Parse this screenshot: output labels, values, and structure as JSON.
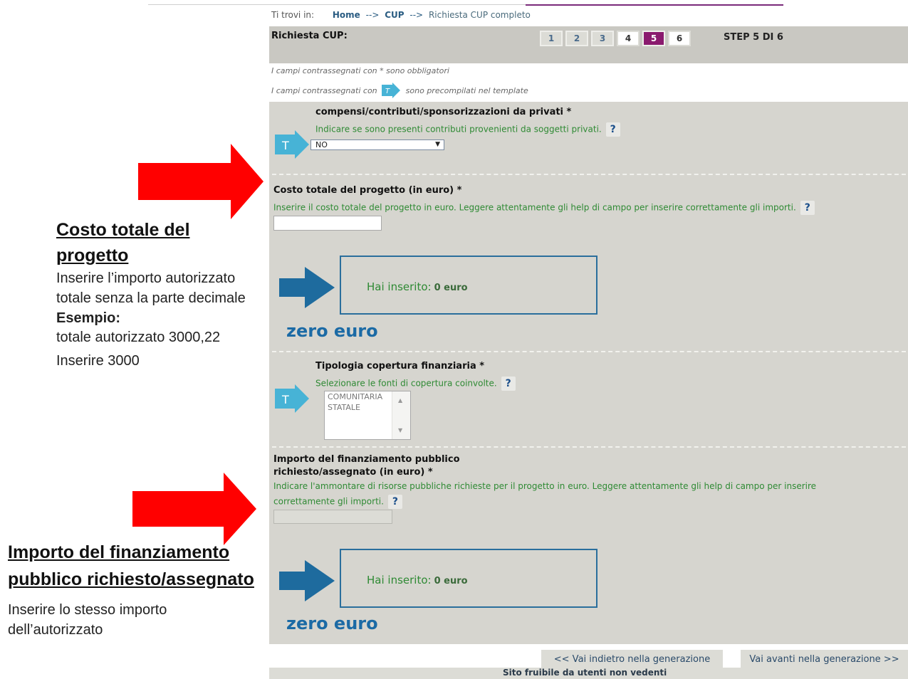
{
  "breadcrumb": {
    "label": "Ti trovi in:",
    "home": "Home",
    "sep1": "-->",
    "cup": "CUP",
    "sep2": "-->",
    "current": "Richiesta CUP completo"
  },
  "stepbar": {
    "title": "Richiesta CUP:",
    "steps": [
      "1",
      "2",
      "3",
      "4",
      "5",
      "6"
    ],
    "active_step": 5,
    "counter": "STEP 5 DI 6"
  },
  "notes": {
    "required": "I campi contrassegnati con * sono obbligatori",
    "prefilled_before": "I campi contrassegnati con",
    "prefilled_after": "sono precompilati nel template"
  },
  "fields": {
    "compensi": {
      "label": "compensi/contributi/sponsorizzazioni da privati *",
      "help": "Indicare se sono presenti contributi provenienti da soggetti privati.",
      "value": "NO"
    },
    "costo": {
      "label": "Costo totale del progetto (in euro) *",
      "help": "Inserire il costo totale del progetto in euro. Leggere attentamente gli help di campo per inserire correttamente gli importi.",
      "value": "",
      "result_label": "Hai inserito:",
      "result_value": "0 euro",
      "zero_text": "zero euro"
    },
    "tipologia": {
      "label": "Tipologia copertura finanziaria *",
      "help": "Selezionare le fonti di copertura coinvolte.",
      "options": [
        "COMUNITARIA",
        "STATALE"
      ]
    },
    "importo": {
      "label_line1": "Importo del finanziamento pubblico",
      "label_line2": "richiesto/assegnato (in euro) *",
      "help_line1": "Indicare l'ammontare di risorse pubbliche richieste per il progetto in euro. Leggere attentamente gli help di campo per inserire",
      "help_line2": "correttamente gli importi.",
      "result_label": "Hai inserito:",
      "result_value": "0 euro",
      "zero_text": "zero euro"
    }
  },
  "help_icon": "?",
  "badge_letter": "T",
  "navigation": {
    "back": "<< Vai indietro nella generazione",
    "forward": "Vai avanti nella generazione >>",
    "accessibility": "Sito fruibile da utenti non vedenti"
  },
  "annotations": {
    "costo": {
      "title_line1": "Costo totale del",
      "title_line2": "progetto",
      "line1": "Inserire l’importo autorizzato",
      "line2": "totale senza la parte decimale",
      "example_label": "Esempio:",
      "example_line": "totale autorizzato 3000,22",
      "insert_line": "Inserire 3000"
    },
    "importo": {
      "title_line1": "Importo del finanziamento",
      "title_line2": "pubblico richiesto/assegnato",
      "line1": "Inserire lo stesso importo",
      "line2": "dell’autorizzato"
    }
  },
  "colors": {
    "active_step": "#8a1a6e",
    "help_text": "#2f8a34",
    "result_border": "#2a6e9c",
    "zero_text": "#1b6aa5",
    "red_arrow": "#ff0000",
    "blue_arrow": "#1e6b9e",
    "t_badge": "#47b3d6"
  },
  "icons": {
    "t_badge": "t-template-badge-icon",
    "help": "question-help-icon",
    "red_arrow": "red-arrow-right-icon",
    "blue_arrow": "blue-arrow-right-icon",
    "dropdown": "dropdown-arrow-icon"
  }
}
